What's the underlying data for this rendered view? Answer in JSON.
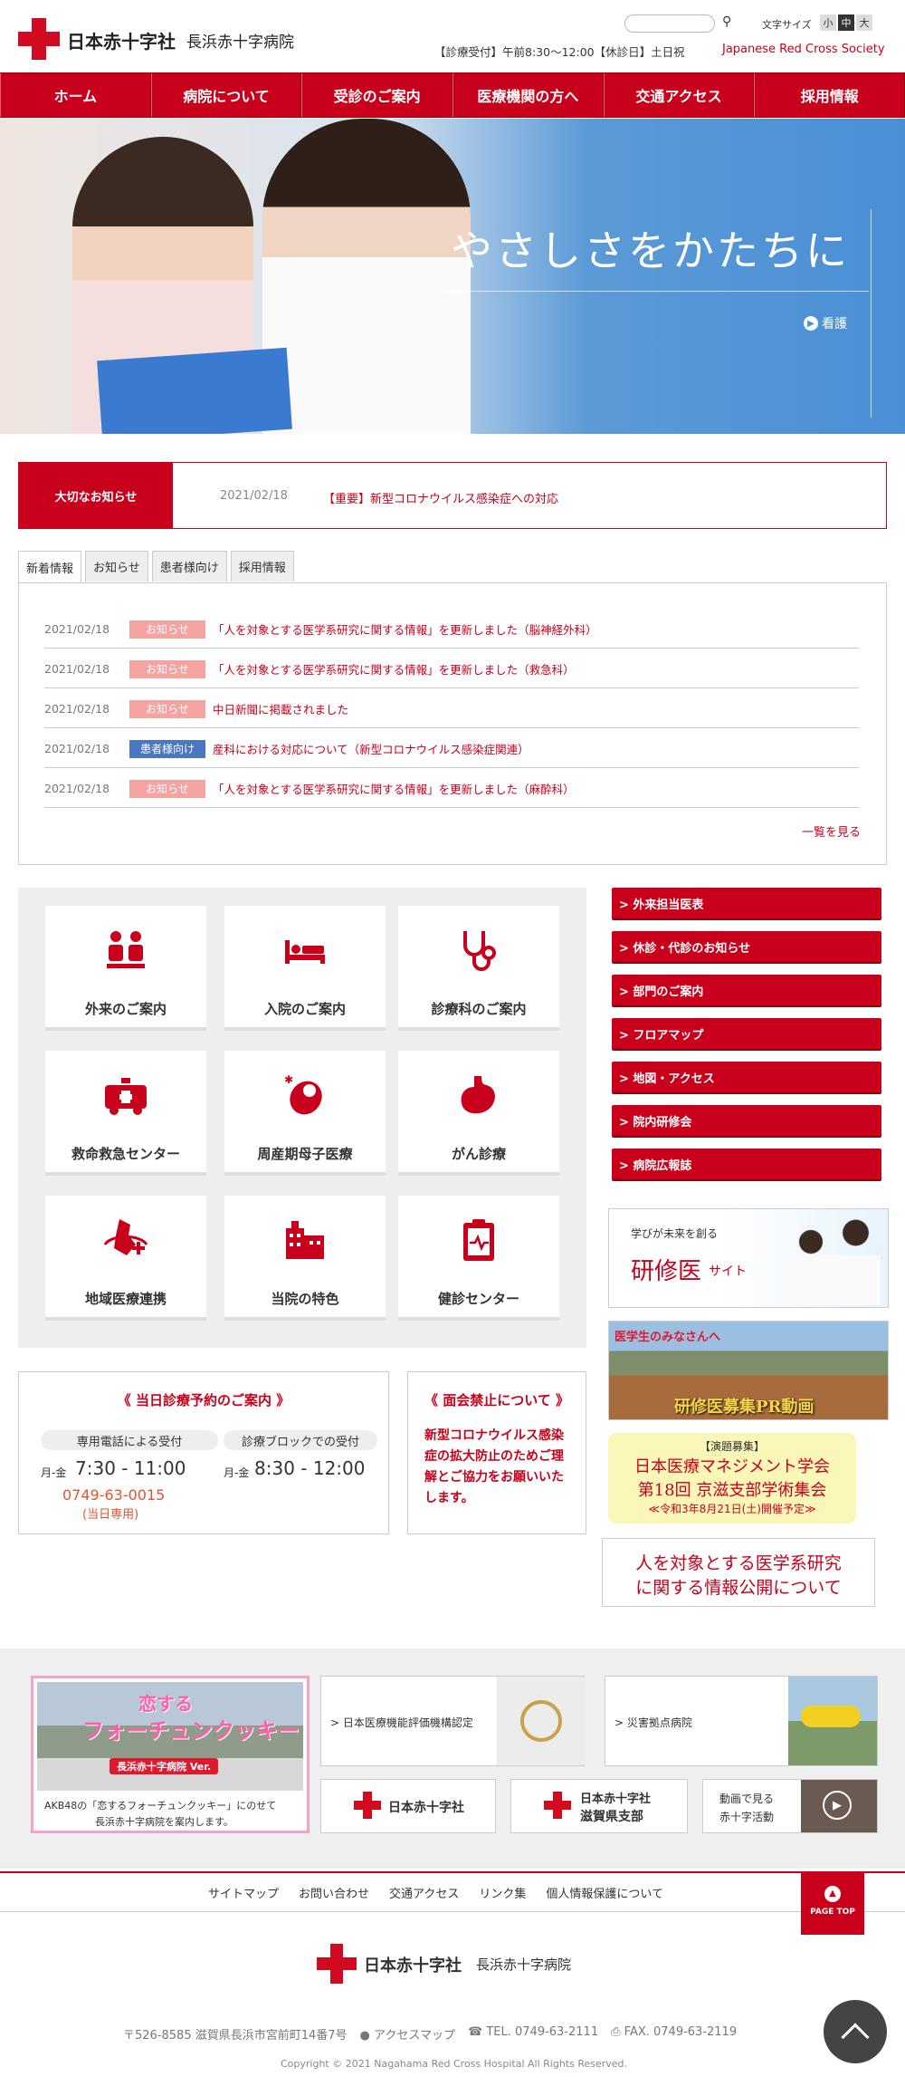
{
  "header": {
    "org_name": "日本赤十字社",
    "hospital_name": "長浜赤十字病院",
    "search_placeholder": "",
    "font_size_label": "文字サイズ",
    "font_sizes": [
      "小",
      "中",
      "大"
    ],
    "hours_text": "【診療受付】午前8:30〜12:00【休診日】土日祝",
    "jrc_link": "Japanese Red Cross Society"
  },
  "nav": [
    "ホーム",
    "病院について",
    "受診のご案内",
    "医療機関の方へ",
    "交通アクセス",
    "採用情報"
  ],
  "hero": {
    "slogan": "やさしさをかたちに",
    "link": "看護"
  },
  "notice": {
    "label": "大切なお知らせ",
    "date": "2021/02/18",
    "text": "【重要】新型コロナウイルス感染症への対応"
  },
  "tabs": [
    "新着情報",
    "お知らせ",
    "患者様向け",
    "採用情報"
  ],
  "news": [
    {
      "date": "2021/02/18",
      "badge": "お知らせ",
      "text": "「人を対象とする医学系研究に関する情報」を更新しました（脳神経外科）"
    },
    {
      "date": "2021/02/18",
      "badge": "お知らせ",
      "text": "「人を対象とする医学系研究に関する情報」を更新しました（救急科）"
    },
    {
      "date": "2021/02/18",
      "badge": "お知らせ",
      "text": "中日新聞に掲載されました"
    },
    {
      "date": "2021/02/18",
      "badge": "患者様向け",
      "text": "産科における対応について（新型コロナウイルス感染症関連）"
    },
    {
      "date": "2021/02/18",
      "badge": "お知らせ",
      "text": "「人を対象とする医学系研究に関する情報」を更新しました（麻酔科）"
    }
  ],
  "more_link": "一覧を見る",
  "cards": [
    "外来のご案内",
    "入院のご案内",
    "診療科のご案内",
    "救命救急センター",
    "周産期母子医療",
    "がん診療",
    "地域医療連携",
    "当院の特色",
    "健診センター"
  ],
  "side_buttons": [
    "> 外来担当医表",
    "> 休診・代診のお知らせ",
    "> 部門のご案内",
    "> フロアマップ",
    "> 地図・アクセス",
    "> 院内研修会",
    "> 病院広報誌"
  ],
  "side_banners": {
    "kenshui_small": "学びが未来を創る",
    "kenshui_big": "研修医",
    "kenshui_site": "サイト",
    "igakusei": "医学生のみなさんへ",
    "pr_video": "研修医募集PR動画",
    "gakkai_tag": "【演題募集】",
    "gakkai_1": "日本医療マネジメント学会",
    "gakkai_2": "第18回 京滋支部学術集会",
    "gakkai_3": "≪令和3年8月21日(土)開催予定≫",
    "research_1": "人を対象とする医学系研究",
    "research_2": "に関する情報公開について"
  },
  "reservation": {
    "title": "《 当日診療予約のご案内 》",
    "phone_label": "専用電話による受付",
    "block_label": "診療ブロックでの受付",
    "days": "月-金",
    "phone_hours": "7:30 - 11:00",
    "block_hours": "8:30 - 12:00",
    "phone_number": "0749-63-0015",
    "phone_note": "(当日専用)"
  },
  "visit": {
    "title": "《 面会禁止について 》",
    "body": "新型コロナウイルス感染症の拡大防止のためご理解とご協力をお願いいたします。"
  },
  "footer_banners": {
    "fortune_title1": "恋する",
    "fortune_title2": "フォーチュンクッキー",
    "fortune_ver": "長浜赤十字病院 Ver.",
    "fortune_desc1": "AKB48の「恋するフォーチュンクッキー」にのせて",
    "fortune_desc2": "長浜赤十字病院を案内します。",
    "hyoka": "> 日本医療機能評価機構認定",
    "saigai": "> 災害拠点病院",
    "jrc": "日本赤十字社",
    "shiga_1": "日本赤十字社",
    "shiga_2": "滋賀県支部",
    "video_1": "動画で見る",
    "video_2": "赤十字活動"
  },
  "footer_links": [
    "サイトマップ",
    "お問い合わせ",
    "交通アクセス",
    "リンク集",
    "個人情報保護について"
  ],
  "pagetop": "PAGE TOP",
  "footer": {
    "org": "日本赤十字社",
    "hospital": "長浜赤十字病院",
    "address": "〒526-8585 滋賀県長浜市宮前町14番7号",
    "access": "アクセスマップ",
    "tel": "TEL. 0749-63-2111",
    "fax": "FAX. 0749-63-2119",
    "copyright": "Copyright © 2021 Nagahama Red Cross Hospital All Rights Reserved."
  },
  "colors": {
    "brand_red": "#c8001b",
    "badge_pink": "#f4a3a0",
    "badge_blue": "#4a77c0"
  }
}
